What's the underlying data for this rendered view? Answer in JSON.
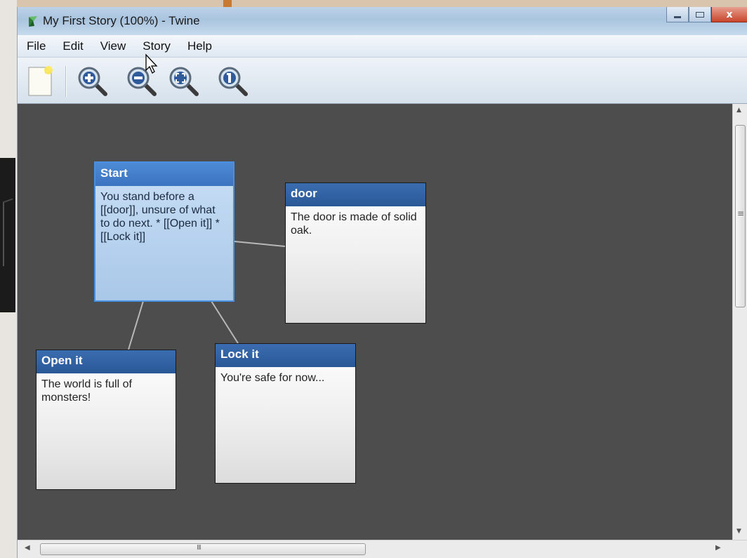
{
  "window": {
    "title": "My First Story (100%) - Twine",
    "controls": {
      "close_glyph": "x"
    }
  },
  "menu": {
    "items": [
      "File",
      "Edit",
      "View",
      "Story",
      "Help"
    ]
  },
  "toolbar": {
    "buttons": [
      {
        "icon": "new-passage-icon"
      },
      {
        "icon": "zoom-in-icon"
      },
      {
        "icon": "zoom-out-icon"
      },
      {
        "icon": "zoom-fit-icon"
      },
      {
        "icon": "zoom-actual-icon"
      }
    ]
  },
  "passages": [
    {
      "title": "Start",
      "body": "You stand before a [[door]], unsure of what to do next. * [[Open it]] * [[Lock it]]",
      "selected": true
    },
    {
      "title": "door",
      "body": "The door is made of solid oak.",
      "selected": false
    },
    {
      "title": "Open it",
      "body": "The world is full of monsters!",
      "selected": false
    },
    {
      "title": "Lock it",
      "body": "You're safe for now...",
      "selected": false
    }
  ],
  "links": [
    [
      "Start",
      "door"
    ],
    [
      "Start",
      "Open it"
    ],
    [
      "Start",
      "Lock it"
    ]
  ],
  "colors": {
    "canvas": "#4d4d4d",
    "passage_title": "#2a5896",
    "selected_title": "#3b74c0",
    "selected_body": "#b6d1ee",
    "link_line": "#b8b8b8"
  }
}
